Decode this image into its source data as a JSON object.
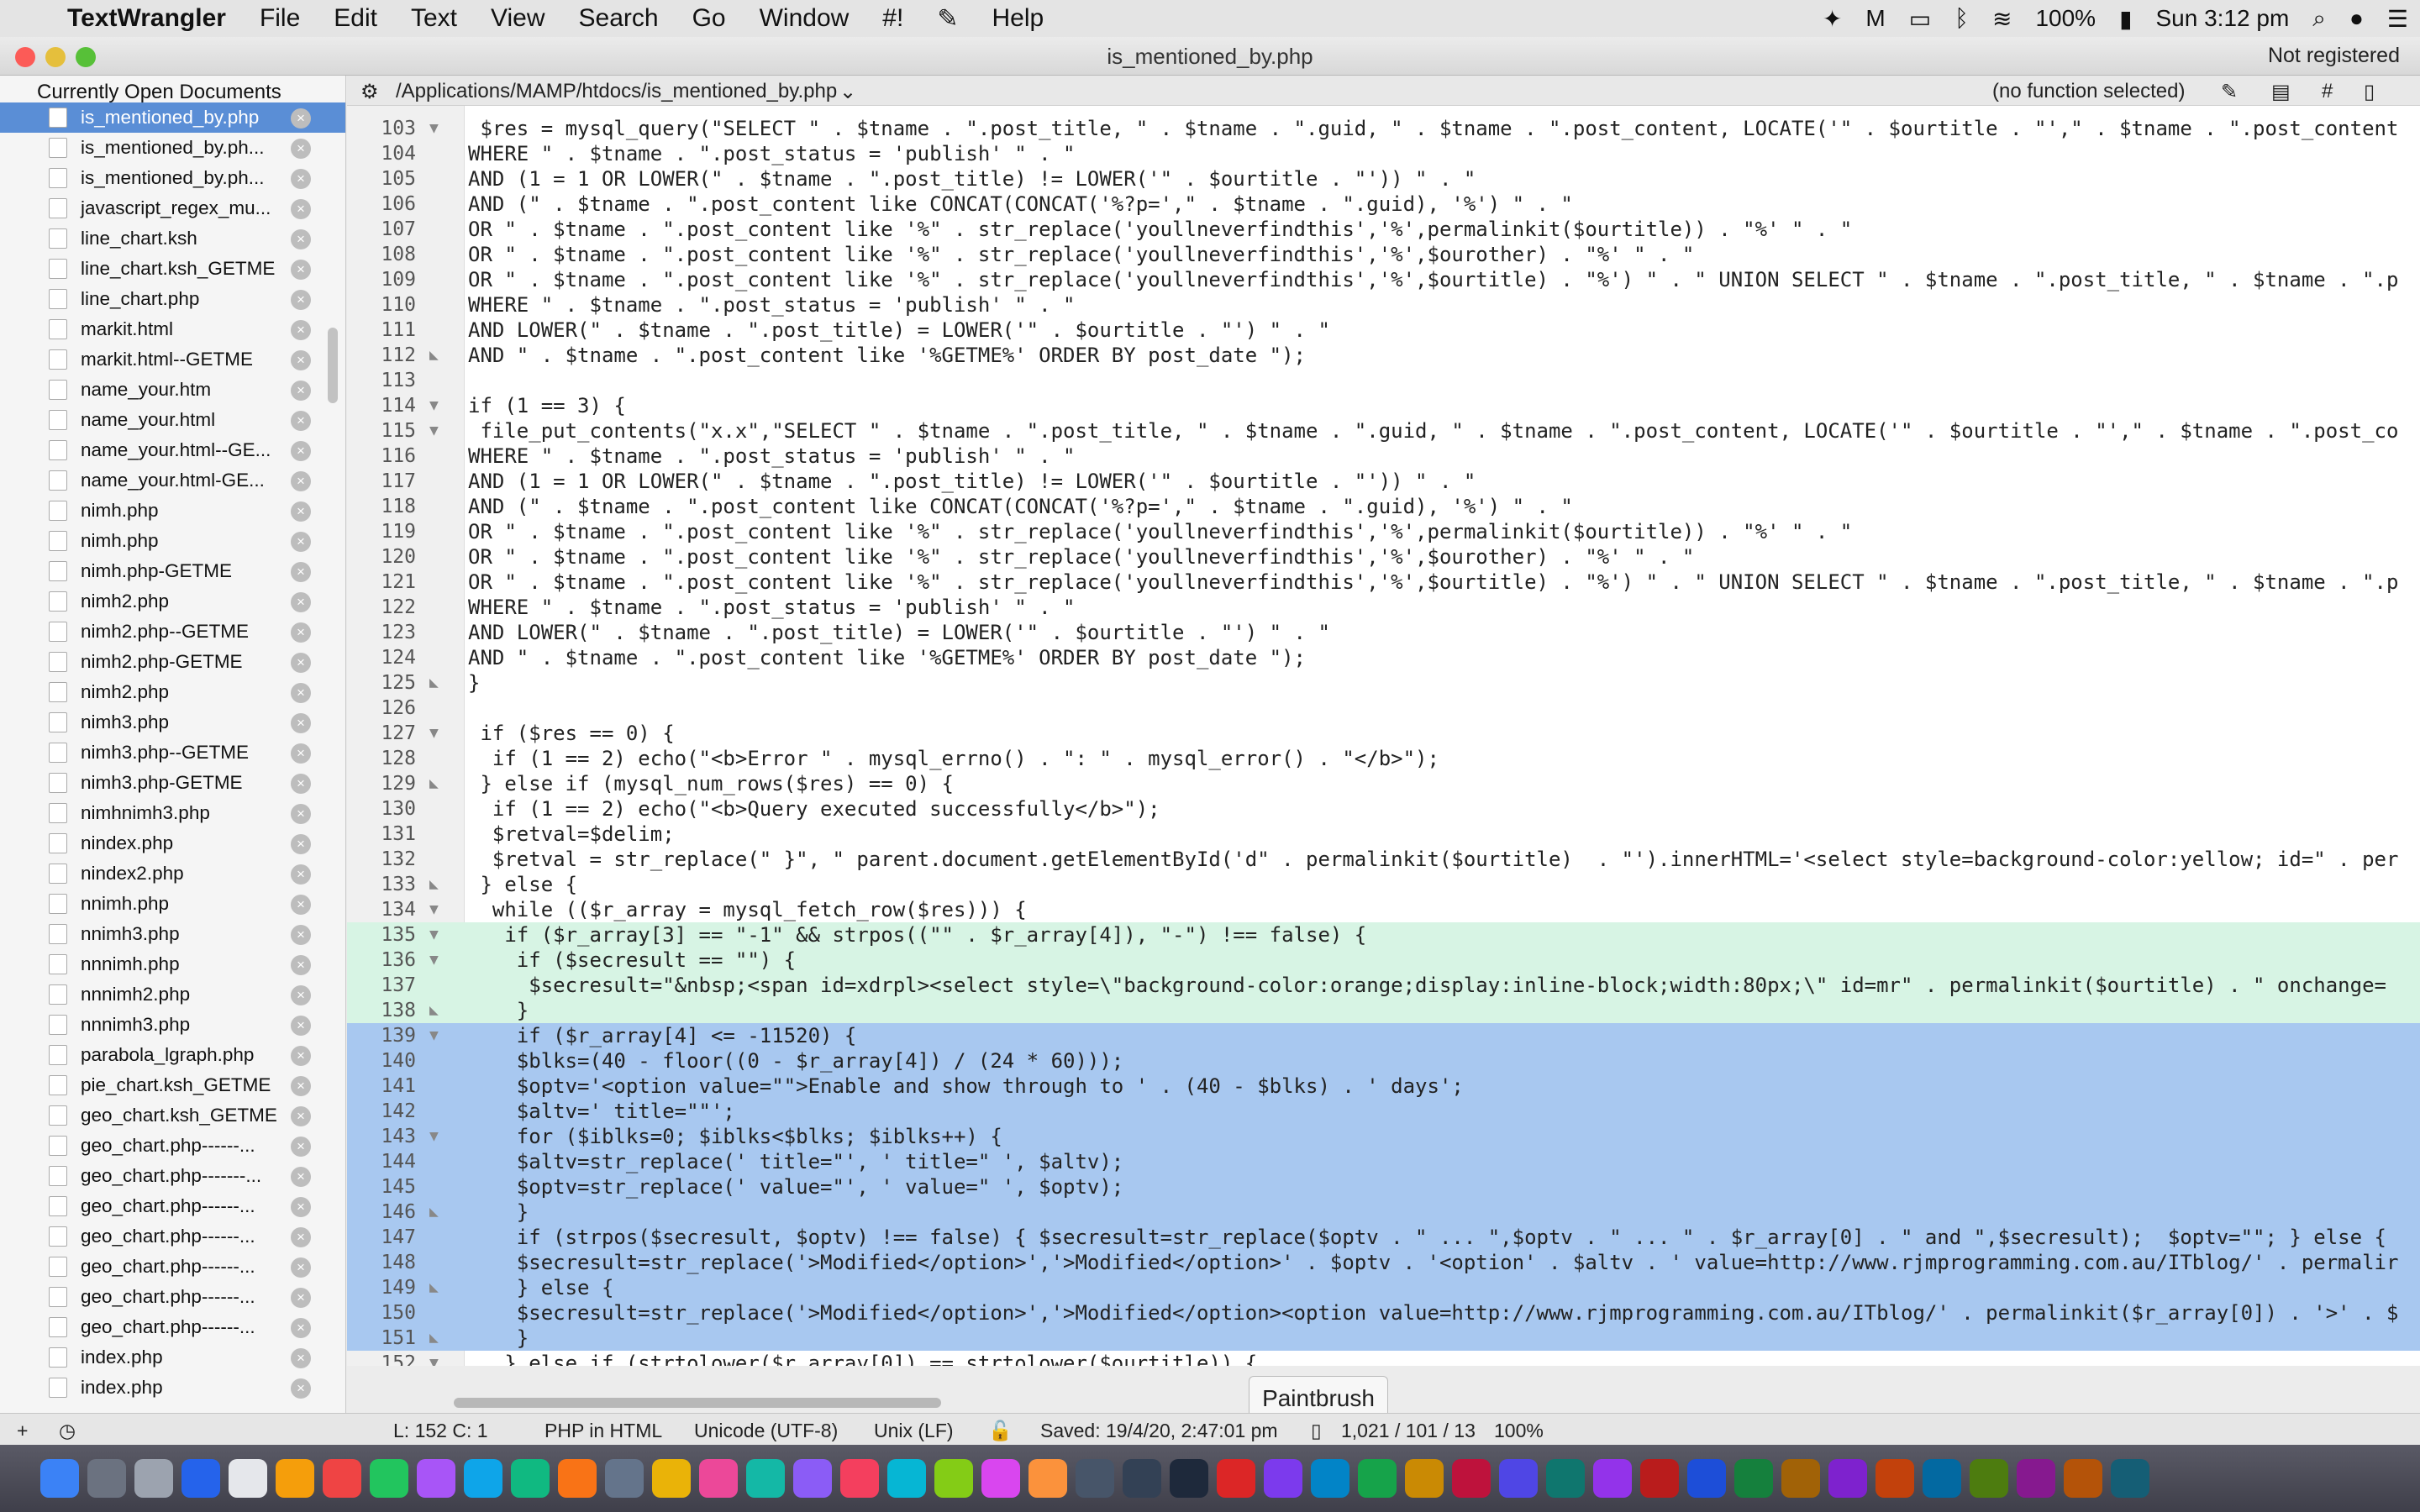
{
  "menubar": {
    "app_name": "TextWrangler",
    "menus": [
      "File",
      "Edit",
      "Text",
      "View",
      "Search",
      "Go",
      "Window",
      "#!",
      "Help"
    ],
    "battery": "100%",
    "clock": "Sun 3:12 pm"
  },
  "window": {
    "title": "is_mentioned_by.php",
    "registration": "Not registered",
    "path": "/Applications/MAMP/htdocs/is_mentioned_by.php",
    "function_menu": "(no function selected)",
    "hash_label": "#"
  },
  "sidebar": {
    "header": "Currently Open Documents",
    "files": [
      {
        "name": "is_mentioned_by.php",
        "selected": true
      },
      {
        "name": "is_mentioned_by.ph..."
      },
      {
        "name": "is_mentioned_by.ph..."
      },
      {
        "name": "javascript_regex_mu..."
      },
      {
        "name": "line_chart.ksh"
      },
      {
        "name": "line_chart.ksh_GETME"
      },
      {
        "name": "line_chart.php"
      },
      {
        "name": "markit.html"
      },
      {
        "name": "markit.html--GETME"
      },
      {
        "name": "name_your.htm"
      },
      {
        "name": "name_your.html"
      },
      {
        "name": "name_your.html--GE..."
      },
      {
        "name": "name_your.html-GE..."
      },
      {
        "name": "nimh.php"
      },
      {
        "name": "nimh.php"
      },
      {
        "name": "nimh.php-GETME"
      },
      {
        "name": "nimh2.php"
      },
      {
        "name": "nimh2.php--GETME"
      },
      {
        "name": "nimh2.php-GETME"
      },
      {
        "name": "nimh2.php"
      },
      {
        "name": "nimh3.php"
      },
      {
        "name": "nimh3.php--GETME"
      },
      {
        "name": "nimh3.php-GETME"
      },
      {
        "name": "nimhnimh3.php"
      },
      {
        "name": "nindex.php"
      },
      {
        "name": "nindex2.php"
      },
      {
        "name": "nnimh.php"
      },
      {
        "name": "nnimh3.php"
      },
      {
        "name": "nnnimh.php"
      },
      {
        "name": "nnnimh2.php"
      },
      {
        "name": "nnnimh3.php"
      },
      {
        "name": "parabola_lgraph.php"
      },
      {
        "name": "pie_chart.ksh_GETME"
      },
      {
        "name": "geo_chart.ksh_GETME"
      },
      {
        "name": "geo_chart.php------..."
      },
      {
        "name": "geo_chart.php-------..."
      },
      {
        "name": "geo_chart.php------..."
      },
      {
        "name": "geo_chart.php------..."
      },
      {
        "name": "geo_chart.php------..."
      },
      {
        "name": "geo_chart.php------..."
      },
      {
        "name": "geo_chart.php------..."
      },
      {
        "name": "index.php"
      },
      {
        "name": "index.php"
      }
    ]
  },
  "code_lines": [
    {
      "n": "103",
      "fold": "▼",
      "t": " $res = mysql_query(\"SELECT \" . $tname . \".post_title, \" . $tname . \".guid, \" . $tname . \".post_content, LOCATE('\" . $ourtitle . \"',\" . $tname . \".post_content"
    },
    {
      "n": "104",
      "fold": "",
      "t": "WHERE \" . $tname . \".post_status = 'publish' \" . \""
    },
    {
      "n": "105",
      "fold": "",
      "t": "AND (1 = 1 OR LOWER(\" . $tname . \".post_title) != LOWER('\" . $ourtitle . \"')) \" . \""
    },
    {
      "n": "106",
      "fold": "",
      "t": "AND (\" . $tname . \".post_content like CONCAT(CONCAT('%?p=',\" . $tname . \".guid), '%') \" . \""
    },
    {
      "n": "107",
      "fold": "",
      "t": "OR \" . $tname . \".post_content like '%\" . str_replace('youllneverfindthis','%',permalinkit($ourtitle)) . \"%' \" . \""
    },
    {
      "n": "108",
      "fold": "",
      "t": "OR \" . $tname . \".post_content like '%\" . str_replace('youllneverfindthis','%',$ourother) . \"%' \" . \""
    },
    {
      "n": "109",
      "fold": "",
      "t": "OR \" . $tname . \".post_content like '%\" . str_replace('youllneverfindthis','%',$ourtitle) . \"%') \" . \" UNION SELECT \" . $tname . \".post_title, \" . $tname . \".p"
    },
    {
      "n": "110",
      "fold": "",
      "t": "WHERE \" . $tname . \".post_status = 'publish' \" . \""
    },
    {
      "n": "111",
      "fold": "",
      "t": "AND LOWER(\" . $tname . \".post_title) = LOWER('\" . $ourtitle . \"') \" . \""
    },
    {
      "n": "112",
      "fold": "◣",
      "t": "AND \" . $tname . \".post_content like '%GETME%' ORDER BY post_date \");"
    },
    {
      "n": "113",
      "fold": "",
      "t": ""
    },
    {
      "n": "114",
      "fold": "▼",
      "t": "if (1 == 3) {"
    },
    {
      "n": "115",
      "fold": "▼",
      "t": " file_put_contents(\"x.x\",\"SELECT \" . $tname . \".post_title, \" . $tname . \".guid, \" . $tname . \".post_content, LOCATE('\" . $ourtitle . \"',\" . $tname . \".post_co"
    },
    {
      "n": "116",
      "fold": "",
      "t": "WHERE \" . $tname . \".post_status = 'publish' \" . \""
    },
    {
      "n": "117",
      "fold": "",
      "t": "AND (1 = 1 OR LOWER(\" . $tname . \".post_title) != LOWER('\" . $ourtitle . \"')) \" . \""
    },
    {
      "n": "118",
      "fold": "",
      "t": "AND (\" . $tname . \".post_content like CONCAT(CONCAT('%?p=',\" . $tname . \".guid), '%') \" . \""
    },
    {
      "n": "119",
      "fold": "",
      "t": "OR \" . $tname . \".post_content like '%\" . str_replace('youllneverfindthis','%',permalinkit($ourtitle)) . \"%' \" . \""
    },
    {
      "n": "120",
      "fold": "",
      "t": "OR \" . $tname . \".post_content like '%\" . str_replace('youllneverfindthis','%',$ourother) . \"%' \" . \""
    },
    {
      "n": "121",
      "fold": "",
      "t": "OR \" . $tname . \".post_content like '%\" . str_replace('youllneverfindthis','%',$ourtitle) . \"%') \" . \" UNION SELECT \" . $tname . \".post_title, \" . $tname . \".p"
    },
    {
      "n": "122",
      "fold": "",
      "t": "WHERE \" . $tname . \".post_status = 'publish' \" . \""
    },
    {
      "n": "123",
      "fold": "",
      "t": "AND LOWER(\" . $tname . \".post_title) = LOWER('\" . $ourtitle . \"') \" . \""
    },
    {
      "n": "124",
      "fold": "",
      "t": "AND \" . $tname . \".post_content like '%GETME%' ORDER BY post_date \");"
    },
    {
      "n": "125",
      "fold": "◣",
      "t": "}"
    },
    {
      "n": "126",
      "fold": "",
      "t": ""
    },
    {
      "n": "127",
      "fold": "▼",
      "t": " if ($res == 0) {"
    },
    {
      "n": "128",
      "fold": "",
      "t": "  if (1 == 2) echo(\"<b>Error \" . mysql_errno() . \": \" . mysql_error() . \"</b>\");"
    },
    {
      "n": "129",
      "fold": "◣",
      "t": " } else if (mysql_num_rows($res) == 0) {"
    },
    {
      "n": "130",
      "fold": "",
      "t": "  if (1 == 2) echo(\"<b>Query executed successfully</b>\");"
    },
    {
      "n": "131",
      "fold": "",
      "t": "  $retval=$delim;"
    },
    {
      "n": "132",
      "fold": "",
      "t": "  $retval = str_replace(\" }\", \" parent.document.getElementById('d\" . permalinkit($ourtitle)  . \"').innerHTML='<select style=background-color:yellow; id=\" . per"
    },
    {
      "n": "133",
      "fold": "◣",
      "t": " } else {"
    },
    {
      "n": "134",
      "fold": "▼",
      "t": "  while (($r_array = mysql_fetch_row($res))) {"
    },
    {
      "n": "135",
      "fold": "▼",
      "t": "   if ($r_array[3] == \"-1\" && strpos((\"\" . $r_array[4]), \"-\") !== false) {",
      "hl": "green"
    },
    {
      "n": "136",
      "fold": "▼",
      "t": "    if ($secresult == \"\") {",
      "hl": "green"
    },
    {
      "n": "137",
      "fold": "",
      "t": "     $secresult=\"&nbsp;<span id=xdrpl><select style=\\\"background-color:orange;display:inline-block;width:80px;\\\" id=mr\" . permalinkit($ourtitle) . \" onchange=",
      "hl": "green"
    },
    {
      "n": "138",
      "fold": "◣",
      "t": "    }",
      "hl": "green"
    },
    {
      "n": "139",
      "fold": "▼",
      "t": "    if ($r_array[4] <= -11520) {",
      "hl": "blue"
    },
    {
      "n": "140",
      "fold": "",
      "t": "    $blks=(40 - floor((0 - $r_array[4]) / (24 * 60)));",
      "hl": "blue"
    },
    {
      "n": "141",
      "fold": "",
      "t": "    $optv='<option value=\"\">Enable and show through to ' . (40 - $blks) . ' days';",
      "hl": "blue"
    },
    {
      "n": "142",
      "fold": "",
      "t": "    $altv=' title=\"\"';",
      "hl": "blue"
    },
    {
      "n": "143",
      "fold": "▼",
      "t": "    for ($iblks=0; $iblks<$blks; $iblks++) {",
      "hl": "blue"
    },
    {
      "n": "144",
      "fold": "",
      "t": "    $altv=str_replace(' title=\"', ' title=\" ', $altv);",
      "hl": "blue"
    },
    {
      "n": "145",
      "fold": "",
      "t": "    $optv=str_replace(' value=\"', ' value=\" ', $optv);",
      "hl": "blue"
    },
    {
      "n": "146",
      "fold": "◣",
      "t": "    }",
      "hl": "blue"
    },
    {
      "n": "147",
      "fold": "",
      "t": "    if (strpos($secresult, $optv) !== false) { $secresult=str_replace($optv . \" ... \",$optv . \" ... \" . $r_array[0] . \" and \",$secresult);  $optv=\"\"; } else {",
      "hl": "blue"
    },
    {
      "n": "148",
      "fold": "",
      "t": "    $secresult=str_replace('>Modified</option>','>Modified</option>' . $optv . '<option' . $altv . ' value=http://www.rjmprogramming.com.au/ITblog/' . permalir",
      "hl": "blue"
    },
    {
      "n": "149",
      "fold": "◣",
      "t": "    } else {",
      "hl": "blue"
    },
    {
      "n": "150",
      "fold": "",
      "t": "    $secresult=str_replace('>Modified</option>','>Modified</option><option value=http://www.rjmprogramming.com.au/ITblog/' . permalinkit($r_array[0]) . '>' . $",
      "hl": "blue"
    },
    {
      "n": "151",
      "fold": "◣",
      "t": "    }",
      "hl": "blue"
    },
    {
      "n": "152",
      "fold": "▼",
      "t": "   } else if (strtolower($r_array[0]) == strtolower($ourtitle)) {"
    }
  ],
  "tooltip": "Paintbrush",
  "statusbar": {
    "position": "L: 152 C: 1",
    "language": "PHP in HTML",
    "encoding": "Unicode (UTF-8)",
    "line_endings": "Unix (LF)",
    "saved": "Saved: 19/4/20, 2:47:01 pm",
    "stats": "1,021 / 101 / 13",
    "zoom": "100%"
  },
  "colors": {
    "selection_blue": "#a8c8f0",
    "highlight_green": "#d7f4e4",
    "sidebar_selected": "#5a8ed6"
  }
}
